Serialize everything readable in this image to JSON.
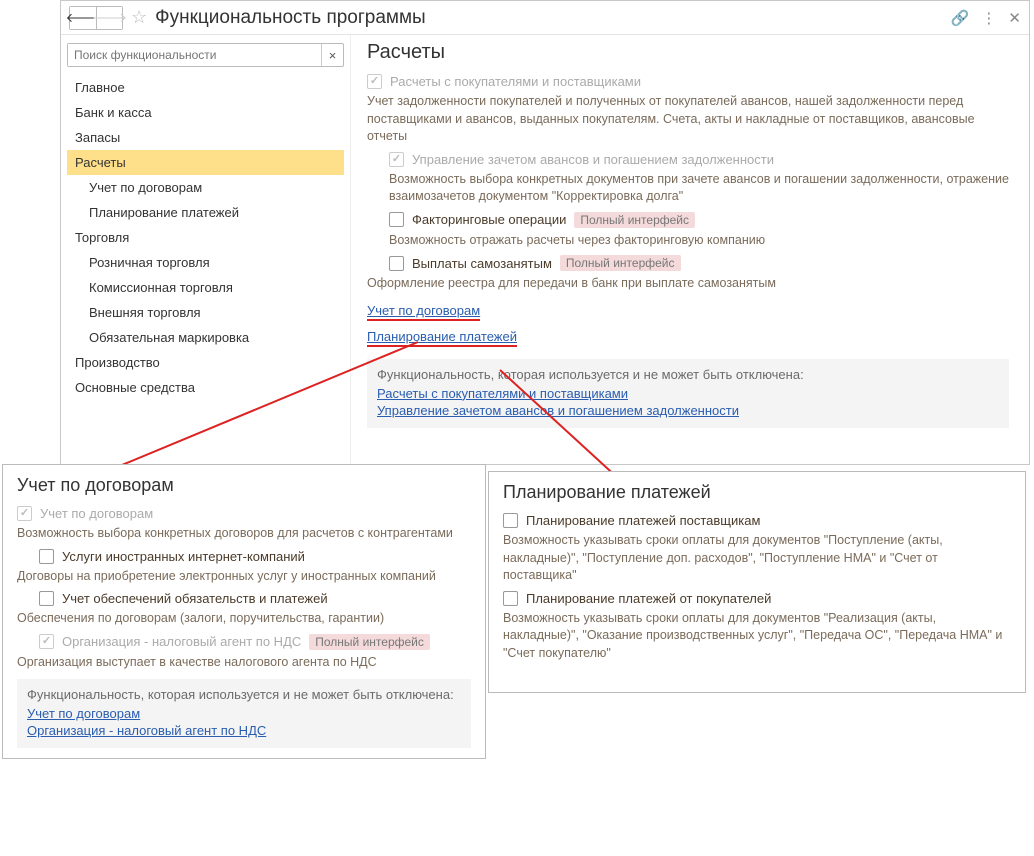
{
  "window": {
    "title": "Функциональность программы",
    "search_placeholder": "Поиск функциональности"
  },
  "sidebar": {
    "items": [
      {
        "label": "Главное",
        "level": 0,
        "sel": false
      },
      {
        "label": "Банк и касса",
        "level": 0,
        "sel": false
      },
      {
        "label": "Запасы",
        "level": 0,
        "sel": false
      },
      {
        "label": "Расчеты",
        "level": 0,
        "sel": true
      },
      {
        "label": "Учет по договорам",
        "level": 1,
        "sel": false
      },
      {
        "label": "Планирование платежей",
        "level": 1,
        "sel": false
      },
      {
        "label": "Торговля",
        "level": 0,
        "sel": false
      },
      {
        "label": "Розничная торговля",
        "level": 1,
        "sel": false
      },
      {
        "label": "Комиссионная торговля",
        "level": 1,
        "sel": false
      },
      {
        "label": "Внешняя торговля",
        "level": 1,
        "sel": false
      },
      {
        "label": "Обязательная маркировка",
        "level": 1,
        "sel": false
      },
      {
        "label": "Производство",
        "level": 0,
        "sel": false
      },
      {
        "label": "Основные средства",
        "level": 0,
        "sel": false
      }
    ]
  },
  "content": {
    "heading": "Расчеты",
    "opt1": {
      "label": "Расчеты с покупателями и поставщиками",
      "desc": "Учет задолженности покупателей и полученных от покупателей авансов, нашей задолженности перед поставщиками и авансов, выданных покупателям. Счета, акты и накладные от поставщиков, авансовые отчеты"
    },
    "opt2": {
      "label": "Управление зачетом авансов и погашением задолженности",
      "desc": "Возможность выбора конкретных документов при зачете авансов и погашении задолженности, отражение взаимозачетов документом \"Корректировка долга\""
    },
    "opt3": {
      "label": "Факторинговые операции",
      "badge": "Полный интерфейс",
      "desc": "Возможность отражать расчеты через факторинговую компанию"
    },
    "opt4": {
      "label": "Выплаты самозанятым",
      "badge": "Полный интерфейс",
      "desc": "Оформление реестра для передачи в банк при выплате самозанятым"
    },
    "link1": "Учет по договорам",
    "link2": "Планирование платежей",
    "locked": {
      "title": "Функциональность, которая используется и не может быть отключена:",
      "a1": "Расчеты с покупателями и поставщиками",
      "a2": "Управление зачетом авансов и погашением задолженности"
    }
  },
  "popup1": {
    "title": "Учет по договорам",
    "opt1": {
      "label": "Учет по договорам",
      "desc": "Возможность выбора конкретных договоров для расчетов с контрагентами"
    },
    "opt2": {
      "label": "Услуги иностранных интернет-компаний",
      "desc": "Договоры на приобретение электронных услуг у иностранных компаний"
    },
    "opt3": {
      "label": "Учет обеспечений обязательств и платежей",
      "desc": "Обеспечения по договорам (залоги, поручительства, гарантии)"
    },
    "opt4": {
      "label": "Организация - налоговый агент по НДС",
      "badge": "Полный интерфейс",
      "desc": "Организация выступает в качестве налогового агента по НДС"
    },
    "locked": {
      "title": "Функциональность, которая используется и не может быть отключена:",
      "a1": "Учет по договорам",
      "a2": "Организация - налоговый агент по НДС"
    }
  },
  "popup2": {
    "title": "Планирование платежей",
    "opt1": {
      "label": "Планирование платежей поставщикам",
      "desc": "Возможность указывать сроки оплаты для документов \"Поступление (акты, накладные)\", \"Поступление доп. расходов\", \"Поступление НМА\" и \"Счет от поставщика\""
    },
    "opt2": {
      "label": "Планирование платежей от покупателей",
      "desc": "Возможность указывать сроки оплаты для документов \"Реализация (акты, накладные)\", \"Оказание производственных услуг\", \"Передача ОС\", \"Передача НМА\" и \"Счет покупателю\""
    }
  }
}
